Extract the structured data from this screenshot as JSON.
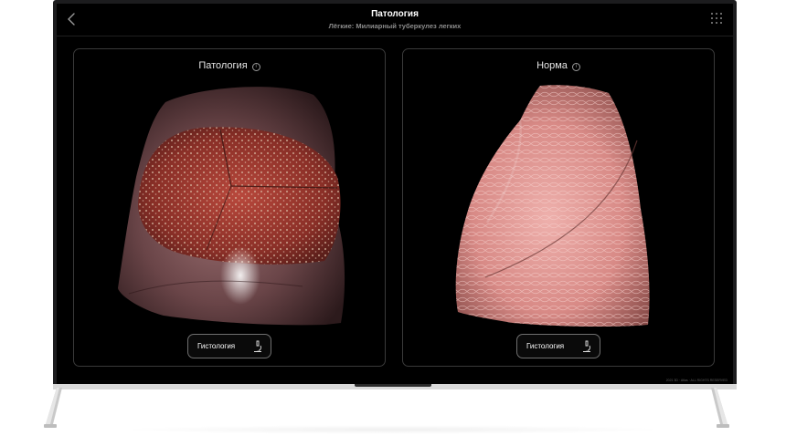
{
  "header": {
    "title": "Патология",
    "subtitle": "Лёгкие: Милиарный туберкулез легких"
  },
  "panels": {
    "left": {
      "heading": "Патология",
      "button": "Гистология"
    },
    "right": {
      "heading": "Норма",
      "button": "Гистология"
    }
  },
  "credit": "2021 3D · Atlas · ALL RIGHTS RESERVED",
  "icons": {
    "back": "chevron-left-icon",
    "menu": "grid-icon",
    "info": "info-icon",
    "histology": "microscope-icon"
  },
  "colors": {
    "screen_bg": "#000000",
    "panel_border": "#3a3a3a",
    "text": "#ffffff",
    "muted": "#8c8c8c"
  }
}
